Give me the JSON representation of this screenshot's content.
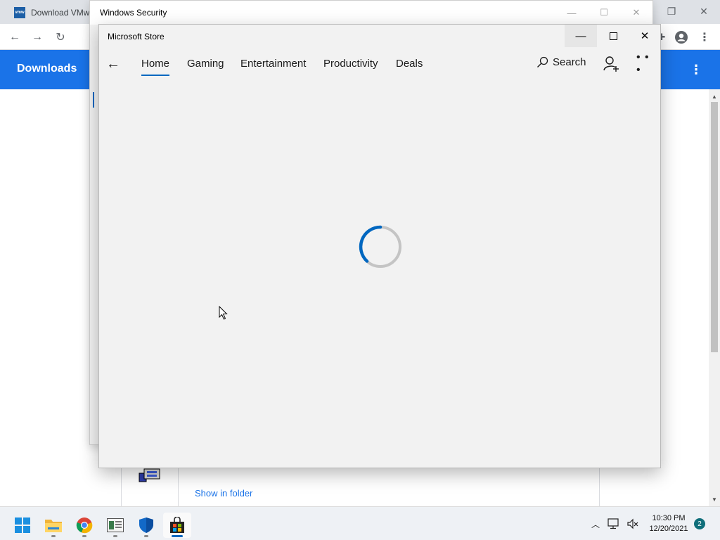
{
  "chrome": {
    "tab_title": "Download VMw",
    "favicon_text": "vmw",
    "page_title": "Downloads",
    "downloads": {
      "show_in_folder": "Show in folder"
    },
    "colors": {
      "accent": "#1a73e8"
    }
  },
  "windows_security": {
    "title": "Windows Security"
  },
  "store": {
    "title": "Microsoft Store",
    "nav": {
      "home": "Home",
      "gaming": "Gaming",
      "entertainment": "Entertainment",
      "productivity": "Productivity",
      "deals": "Deals"
    },
    "search_label": "Search",
    "status": "loading",
    "colors": {
      "accent": "#0067c0"
    }
  },
  "taskbar": {
    "apps": [
      "start-icon",
      "file-explorer-icon",
      "chrome-icon",
      "settings-app-icon",
      "windows-security-icon",
      "microsoft-store-icon"
    ],
    "time": "10:30 PM",
    "date": "12/20/2021",
    "notification_count": "2"
  }
}
